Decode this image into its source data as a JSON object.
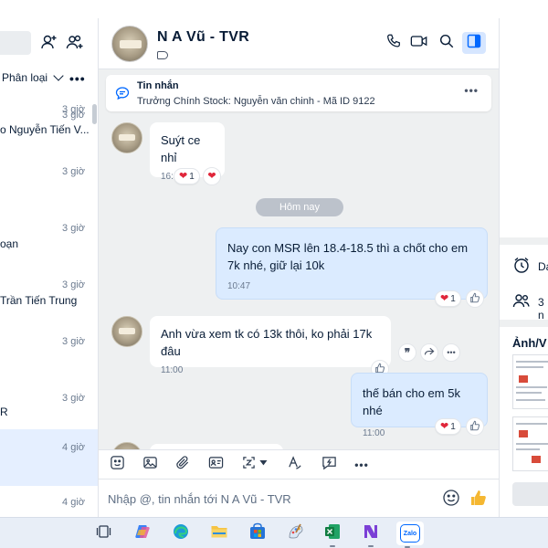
{
  "left_panel": {
    "filter_label": "Phân loại",
    "more_label": "•••",
    "conversations": [
      {
        "time": "3 giờ",
        "name": ""
      },
      {
        "time": "3 giờ",
        "name": "o Nguyễn Tiến V..."
      },
      {
        "time": "3 giờ",
        "name": ""
      },
      {
        "time": "3 giờ",
        "name": "oạn"
      },
      {
        "time": "3 giờ",
        "name": "Trần Tiến Trung"
      },
      {
        "time": "3 giờ",
        "name": ""
      },
      {
        "time": "3 giờ",
        "name": "R"
      },
      {
        "time": "4 giờ",
        "name": ""
      },
      {
        "time": "4 giờ",
        "name": ""
      }
    ]
  },
  "chat": {
    "header": {
      "name": "N A Vũ - TVR"
    },
    "pinned": {
      "title": "Tin nhắn",
      "text": "Trưởng Chính Stock: Nguyễn văn chinh - Mã ID 9122"
    },
    "day_separator": "Hôm nay",
    "messages": [
      {
        "direction": "in",
        "text": "Suýt ce nhỉ",
        "time": "16:38",
        "reactions": [
          "❤ 1",
          "❤"
        ]
      },
      {
        "direction": "out",
        "text": "Nay con MSR lên 18.4-18.5 thì a chốt cho em 7k nhé, giữ lại 10k",
        "time": "10:47",
        "reaction_count": "1"
      },
      {
        "direction": "in",
        "text": "Anh  vừa xem tk có 13k thôi, ko phải 17k đâu",
        "time": "11:00"
      },
      {
        "direction": "out",
        "text": "thế bán cho em 5k nhé",
        "time": "11:00",
        "reaction_count": "1"
      }
    ],
    "composer": {
      "placeholder": "Nhập @, tin nhắn tới N A Vũ - TVR"
    }
  },
  "right_panel": {
    "date_label": "Da",
    "members_label": "3 n",
    "media_title": "Ảnh/V"
  },
  "taskbar": {
    "zalo_label": "Zalo"
  }
}
